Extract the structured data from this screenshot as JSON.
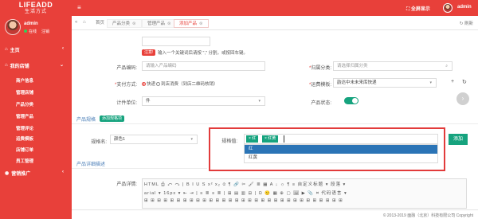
{
  "brand": {
    "line1": "LIFEADD",
    "line2": "生活方式"
  },
  "user": {
    "name": "admin",
    "status": "在线",
    "logout": "注销"
  },
  "sidebar": {
    "home": "主页",
    "shop": "我的店铺",
    "items": [
      "商户信息",
      "管理店铺",
      "产品分类",
      "管理产品",
      "管理评论",
      "运费模板",
      "店铺订单",
      "员工管理"
    ],
    "marketing": "营销推广"
  },
  "topbar": {
    "fullscreen": "全屏显示",
    "username": "admin"
  },
  "tabs": {
    "home": "首页",
    "list": [
      {
        "label": "产品分类"
      },
      {
        "label": "管理产品"
      },
      {
        "label": "添加产品"
      }
    ],
    "refresh": "刷新"
  },
  "form": {
    "keywords_label": "关键词:",
    "keywords_badge": "注意!",
    "keywords_hint": "输入一个关键词后请按 \",\" 分割，或按回车键。",
    "code_label": "产品编码:",
    "code_placeholder": "请输入产品编码",
    "category_label": "归属分类:",
    "category_placeholder": "请选择归属分类",
    "pay_label": "支付方式:",
    "pay_opt1": "快递",
    "pay_opt2": "到店消费（到店二维码核销）",
    "shipping_label": "运费模板:",
    "shipping_value": "韵达中未未来库快递",
    "unit_label": "计件单位:",
    "unit_value": "件",
    "status_label": "产品状态:"
  },
  "spec": {
    "section": "产品规格",
    "add_spec_badge": "添加规格项",
    "name_label": "规格名:",
    "name_value": "颜色1",
    "value_label": "规格值:",
    "tags": [
      "× 红",
      "× 红黄"
    ],
    "options": [
      "红",
      "红黄"
    ],
    "add_button": "添加"
  },
  "detail": {
    "section": "产品详细描述",
    "label": "产品详情:",
    "toolbar_row1": "HTML ⎙ ↶ ↷ | B I U S x² x₂ ⌀ ¶ 🔗 ✂ 🖌 ≣ ▦ A ↓ ☼ ¶ ≡ 自定义标题 ▾ 段落 ▾",
    "toolbar_row2": "arial ▾ 16px ▾ ⇤ ⇥ | ≡ ≣ ≡ ≣ | ⊞ ▤ ▥ ⊟ | Ω 🙂 ▦ ⊕ ▢ 🖼 ▶ 📎 ⌗ 代码语言 ▾",
    "toolbar_row3": "⊞ ⊞ ⊞ ⊞ ⊞ ⊞ ⊞ ⊞ ⊞ ⊞ ⊞ ⊞ ⊞ ⊞ ⊞ ⊞ ⊞ ⊞ ⊞ ⊞ ⊞ ⊞ ⊞ ⊞ ⊞ ⊞ ⊞ ⊞ ⊞ ⊞ ⊞"
  },
  "ime": {
    "s": "S",
    "zh": "中",
    "comma": "•,"
  },
  "footer": {
    "copyright": "© 2013-2019 面融（北京）科技有限公司 Copyright"
  },
  "colors": {
    "primary": "#e8403a",
    "green": "#16a37e",
    "blue": "#2b74b6"
  }
}
